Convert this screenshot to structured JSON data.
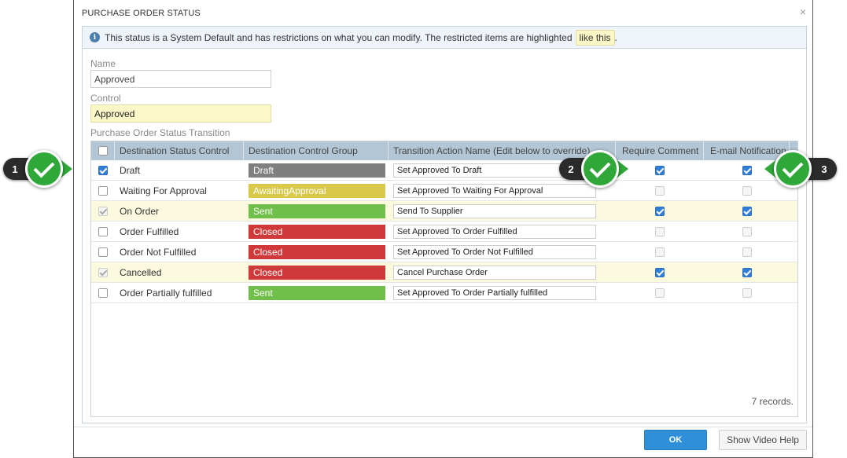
{
  "dialog": {
    "title": "PURCHASE ORDER STATUS",
    "close_glyph": "×",
    "info_text": "This status is a System Default and has restrictions on what you can modify. The restricted items are highlighted",
    "info_highlight_sample": "like this",
    "info_end": ".",
    "info_icon": "info-icon"
  },
  "form": {
    "name_label": "Name",
    "name_value": "Approved",
    "control_label": "Control",
    "control_value": "Approved",
    "section_label": "Purchase Order Status Transition"
  },
  "grid": {
    "headers": [
      "Destination Status Control",
      "Destination Control Group",
      "Transition Action Name (Edit below to override)",
      "Require Comment",
      "E-mail Notification"
    ],
    "rows": [
      {
        "selected": true,
        "disabled": false,
        "highlight": false,
        "status": "Draft",
        "group": "Draft",
        "group_color": "#7f7f7f",
        "action": "Set Approved To Draft",
        "require_comment": true,
        "require_enabled": true,
        "email": true,
        "email_enabled": true
      },
      {
        "selected": false,
        "disabled": false,
        "highlight": false,
        "status": "Waiting For Approval",
        "group": "AwaitingApproval",
        "group_color": "#d8c94a",
        "action": "Set Approved To Waiting For Approval",
        "require_comment": false,
        "require_enabled": false,
        "email": false,
        "email_enabled": false
      },
      {
        "selected": true,
        "disabled": true,
        "highlight": true,
        "status": "On Order",
        "group": "Sent",
        "group_color": "#6fbf4a",
        "action": "Send To Supplier",
        "require_comment": true,
        "require_enabled": true,
        "email": true,
        "email_enabled": true
      },
      {
        "selected": false,
        "disabled": false,
        "highlight": false,
        "status": "Order Fulfilled",
        "group": "Closed",
        "group_color": "#d0393a",
        "action": "Set Approved To Order Fulfilled",
        "require_comment": false,
        "require_enabled": false,
        "email": false,
        "email_enabled": false
      },
      {
        "selected": false,
        "disabled": false,
        "highlight": false,
        "status": "Order Not Fulfilled",
        "group": "Closed",
        "group_color": "#d0393a",
        "action": "Set Approved To Order Not Fulfilled",
        "require_comment": false,
        "require_enabled": false,
        "email": false,
        "email_enabled": false
      },
      {
        "selected": true,
        "disabled": true,
        "highlight": true,
        "status": "Cancelled",
        "group": "Closed",
        "group_color": "#d0393a",
        "action": "Cancel Purchase Order",
        "require_comment": true,
        "require_enabled": true,
        "email": true,
        "email_enabled": true
      },
      {
        "selected": false,
        "disabled": false,
        "highlight": false,
        "status": "Order Partially fulfilled",
        "group": "Sent",
        "group_color": "#6fbf4a",
        "action": "Set Approved To Order Partially fulfilled",
        "require_comment": false,
        "require_enabled": false,
        "email": false,
        "email_enabled": false
      }
    ],
    "records_text": "7 records."
  },
  "footer": {
    "ok_label": "OK",
    "help_label": "Show Video Help"
  },
  "callouts": [
    {
      "number": "1",
      "icon": "check-icon"
    },
    {
      "number": "2",
      "icon": "check-icon"
    },
    {
      "number": "3",
      "icon": "check-icon"
    }
  ],
  "colors": {
    "accent": "#2f8fd8",
    "restricted_highlight": "#fbf7c7",
    "callout_green": "#2fa839",
    "header_bg": "#b3c6d5"
  }
}
